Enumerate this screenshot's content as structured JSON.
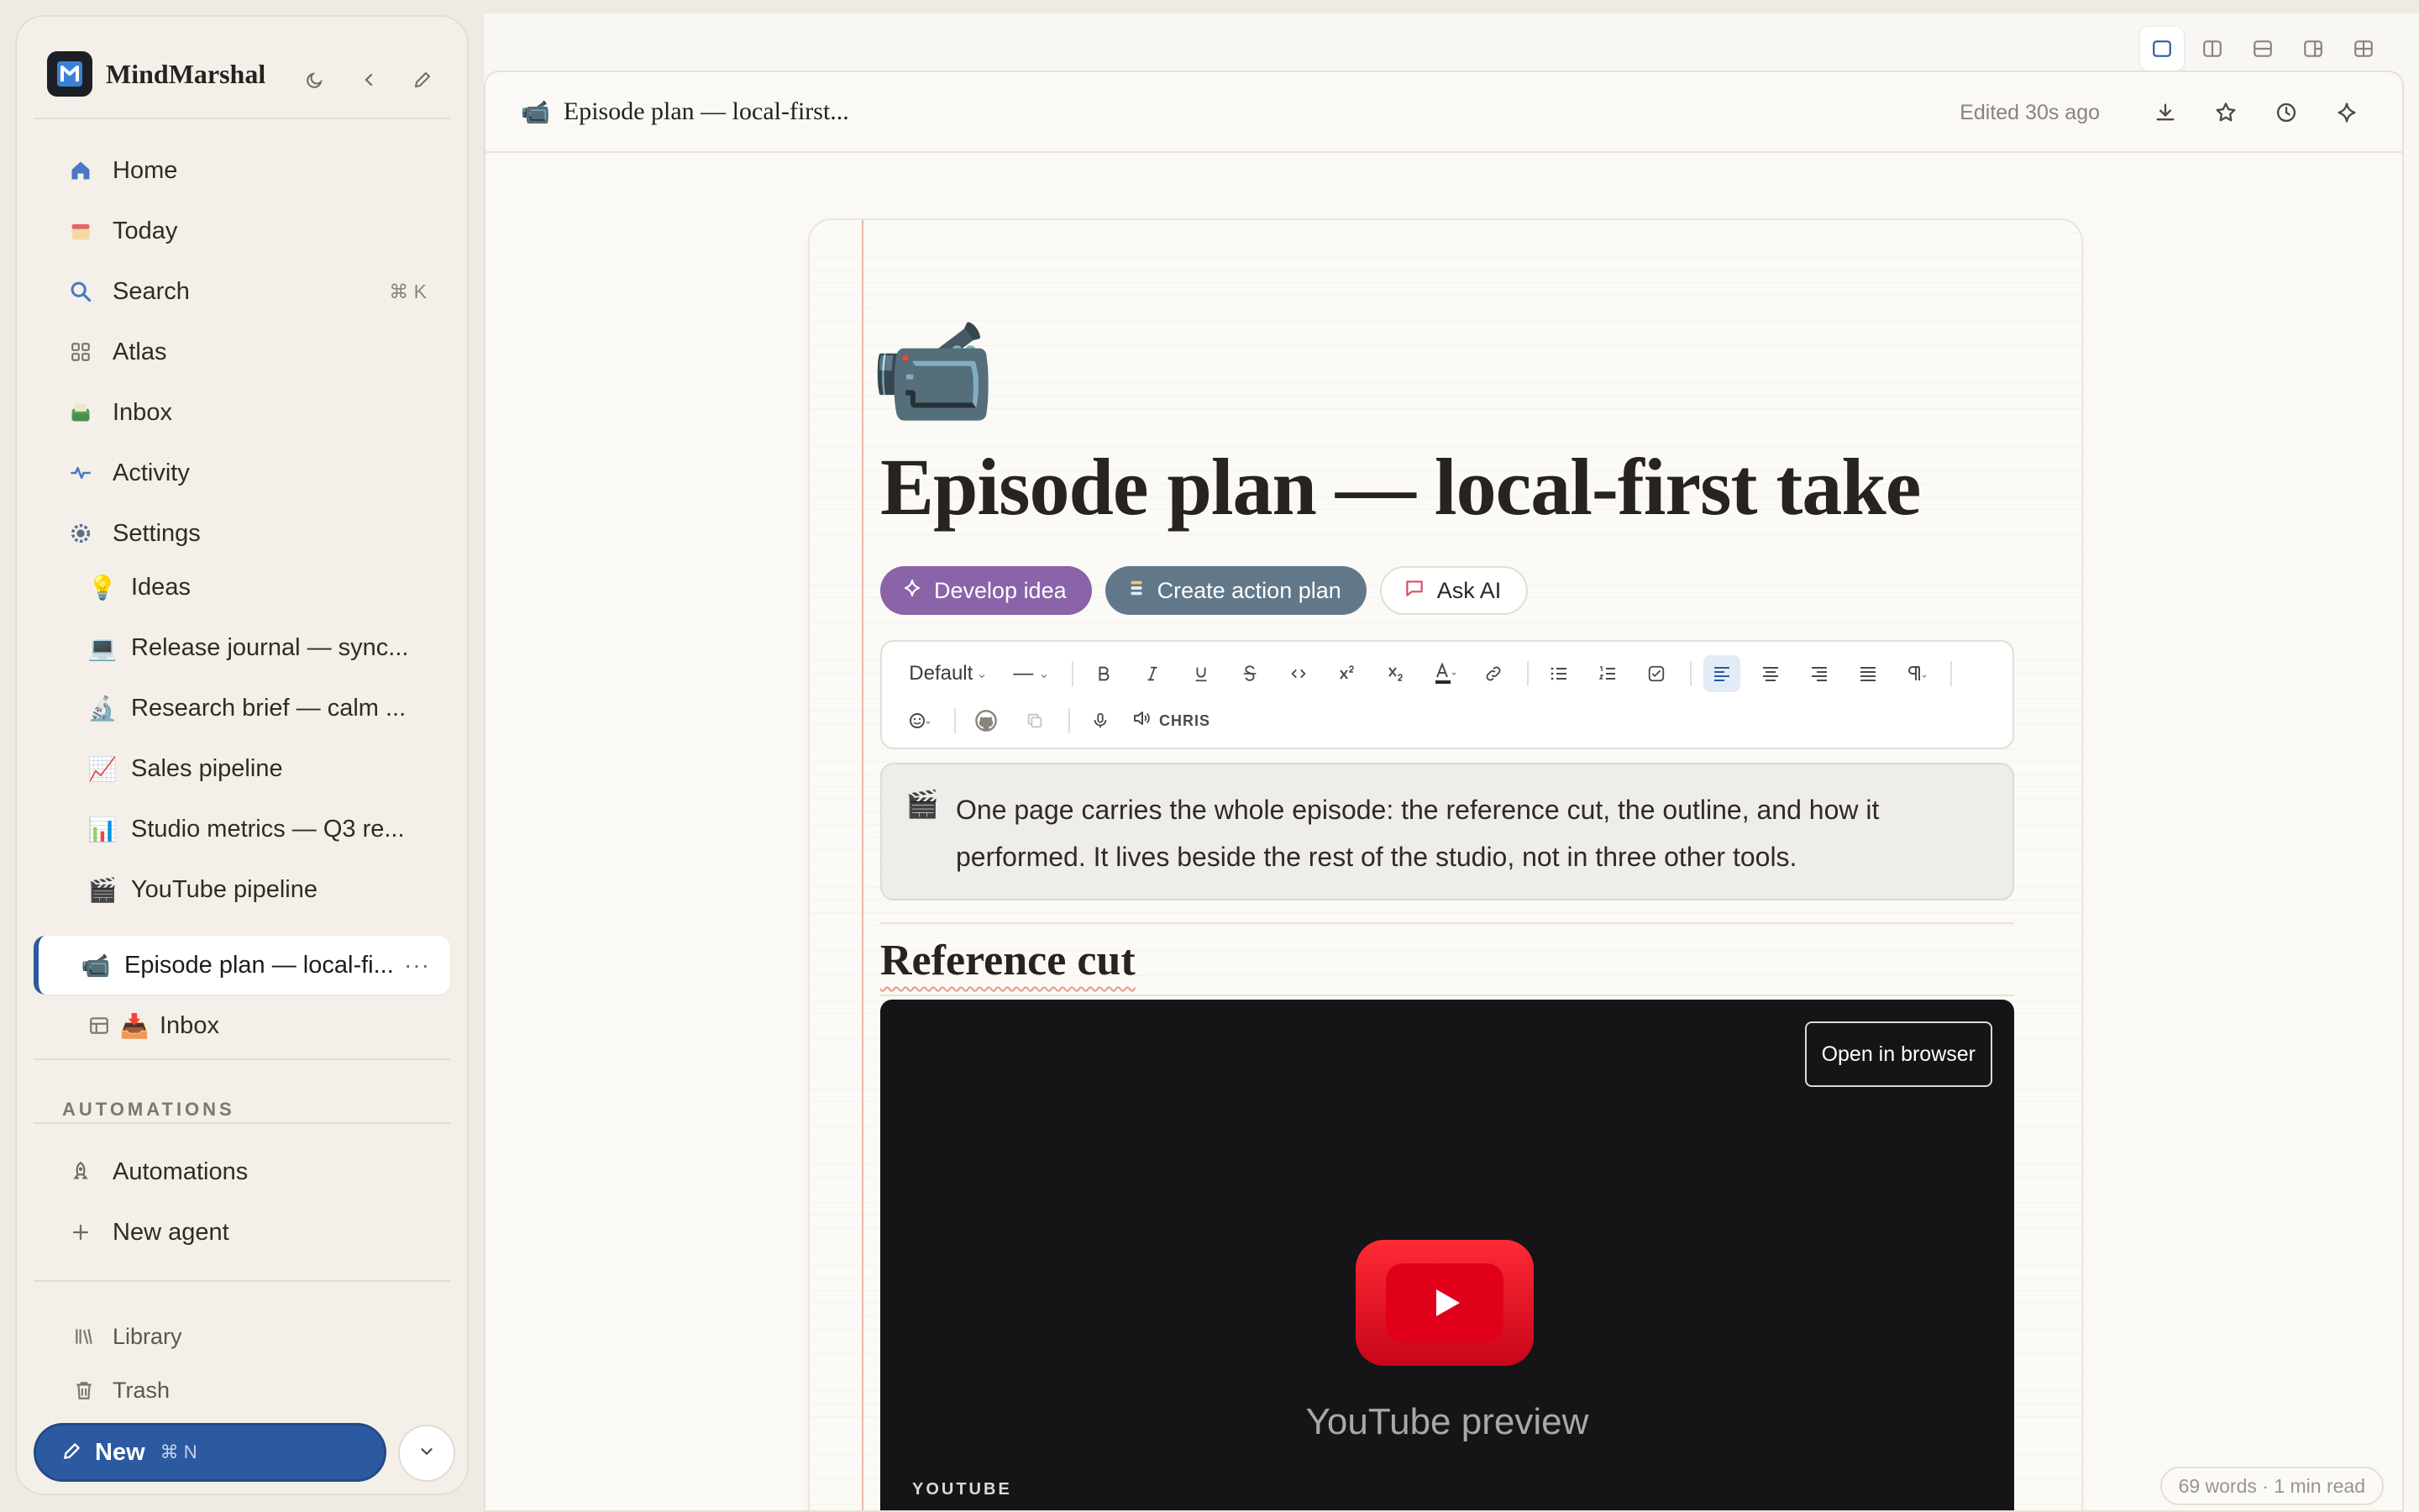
{
  "sidebar": {
    "brand": {
      "name": "MindMarshal"
    },
    "nav": [
      {
        "label": "Home",
        "icon": "home-icon"
      },
      {
        "label": "Today",
        "icon": "calendar-icon"
      },
      {
        "label": "Search",
        "icon": "search-icon",
        "shortcut": "⌘ K"
      },
      {
        "label": "Atlas",
        "icon": "grid-icon"
      },
      {
        "label": "Inbox",
        "icon": "inbox-icon"
      },
      {
        "label": "Activity",
        "icon": "activity-icon"
      },
      {
        "label": "Settings",
        "icon": "gear-icon"
      }
    ],
    "pages": [
      {
        "label": "Ideas",
        "emoji": "💡"
      },
      {
        "label": "Release journal — sync...",
        "emoji": "💻"
      },
      {
        "label": "Research brief — calm ...",
        "emoji": "🔬"
      },
      {
        "label": "Sales pipeline",
        "emoji": "📈"
      },
      {
        "label": "Studio metrics — Q3 re...",
        "emoji": "📊"
      },
      {
        "label": "YouTube pipeline",
        "emoji": "🎬"
      },
      {
        "label": "Episode plan — local-fi...",
        "emoji": "📹",
        "more": "···"
      },
      {
        "label": "Inbox",
        "emoji": "📥"
      }
    ],
    "automations_header": "AUTOMATIONS",
    "automations": [
      {
        "label": "Automations",
        "icon": "rocket-icon"
      },
      {
        "label": "New agent",
        "icon": "plus-icon"
      }
    ],
    "footer": [
      {
        "label": "Library",
        "icon": "library-icon"
      },
      {
        "label": "Trash",
        "icon": "trash-icon"
      }
    ],
    "new_button": {
      "label": "New",
      "shortcut": "⌘ N"
    }
  },
  "header": {
    "emoji": "📹",
    "title": "Episode plan — local-first...",
    "edited": "Edited 30s ago"
  },
  "document": {
    "cover_emoji": "📹",
    "title": "Episode plan — local-first take",
    "actions": {
      "develop": "Develop idea",
      "action_plan": "Create action plan",
      "ask_ai": "Ask AI"
    },
    "toolbar": {
      "style": "Default",
      "divider_menu": "—",
      "voice": "CHRIS"
    },
    "callout": {
      "emoji": "🎬",
      "text": "One page carries the whole episode: the reference cut, the outline, and how it performed. It lives beside the rest of the studio, not in three other tools."
    },
    "section_heading": "Reference cut",
    "video": {
      "open_label": "Open in browser",
      "caption": "YouTube preview",
      "source": "YOUTUBE"
    }
  },
  "status": {
    "word_count": "69 words · 1 min read"
  },
  "colors": {
    "accent": "#2c5aa0",
    "develop_pill": "#8a63a8",
    "action_pill": "#627889",
    "youtube_red": "#ff0033"
  }
}
